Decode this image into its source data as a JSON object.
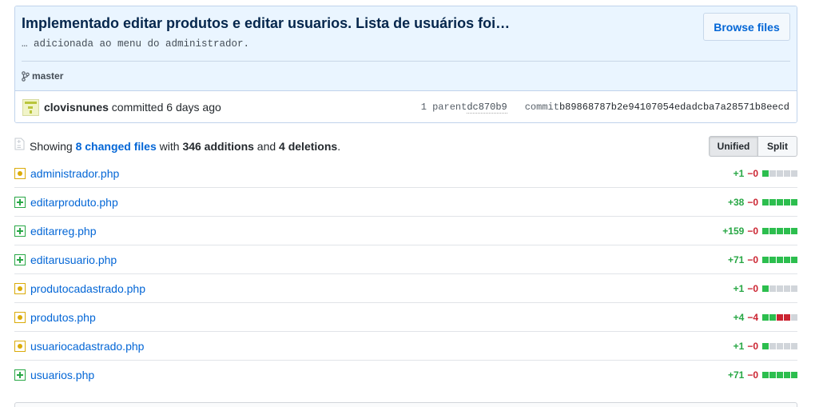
{
  "commit": {
    "title": "Implementado editar produtos e editar usuarios. Lista de usuários foi…",
    "description": "… adicionada ao menu do administrador.",
    "browse_label": "Browse files",
    "branch": "master",
    "author": "clovisnunes",
    "action": " committed 6 days ago",
    "parent_label": "1 parent ",
    "parent_sha": "dc870b9",
    "commit_label": "commit ",
    "commit_sha": "b89868787b2e94107054edadcba7a28571b8eecd"
  },
  "toc": {
    "showing": "Showing ",
    "changed_files": "8 changed files",
    "with": " with ",
    "additions": "346 additions",
    "and": " and ",
    "deletions": "4 deletions",
    "period": ".",
    "unified_label": "Unified",
    "split_label": "Split"
  },
  "files": [
    {
      "name": "administrador.php",
      "status": "modified",
      "additions": "+1",
      "deletions": "−0",
      "blocks": [
        "add",
        "neu",
        "neu",
        "neu",
        "neu"
      ]
    },
    {
      "name": "editarproduto.php",
      "status": "added",
      "additions": "+38",
      "deletions": "−0",
      "blocks": [
        "add",
        "add",
        "add",
        "add",
        "add"
      ]
    },
    {
      "name": "editarreg.php",
      "status": "added",
      "additions": "+159",
      "deletions": "−0",
      "blocks": [
        "add",
        "add",
        "add",
        "add",
        "add"
      ]
    },
    {
      "name": "editarusuario.php",
      "status": "added",
      "additions": "+71",
      "deletions": "−0",
      "blocks": [
        "add",
        "add",
        "add",
        "add",
        "add"
      ]
    },
    {
      "name": "produtocadastrado.php",
      "status": "modified",
      "additions": "+1",
      "deletions": "−0",
      "blocks": [
        "add",
        "neu",
        "neu",
        "neu",
        "neu"
      ]
    },
    {
      "name": "produtos.php",
      "status": "modified",
      "additions": "+4",
      "deletions": "−4",
      "blocks": [
        "add",
        "add",
        "del",
        "del",
        "neu"
      ]
    },
    {
      "name": "usuariocadastrado.php",
      "status": "modified",
      "additions": "+1",
      "deletions": "−0",
      "blocks": [
        "add",
        "neu",
        "neu",
        "neu",
        "neu"
      ]
    },
    {
      "name": "usuarios.php",
      "status": "added",
      "additions": "+71",
      "deletions": "−0",
      "blocks": [
        "add",
        "add",
        "add",
        "add",
        "add"
      ]
    }
  ],
  "colors": {
    "link": "#0366d6",
    "addition": "#28a745",
    "deletion": "#cb2431",
    "modified_icon": "#dbab09",
    "commit_bg": "#eaf5ff"
  }
}
